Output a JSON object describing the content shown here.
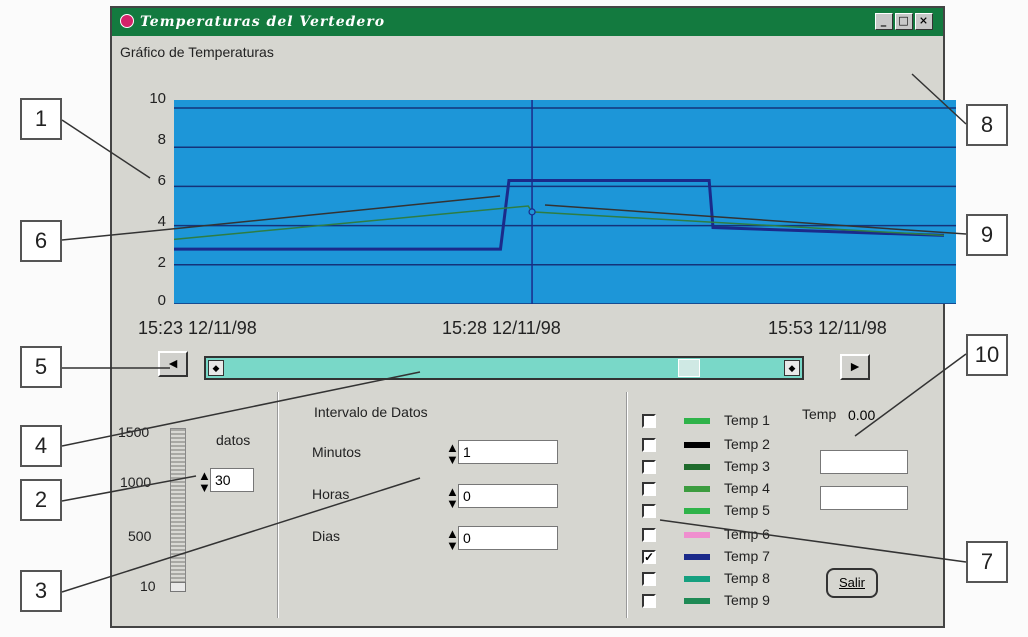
{
  "window": {
    "title": "Temperaturas del Vertedero",
    "controls": [
      "_",
      "□",
      "×"
    ]
  },
  "chart_title": "Gráfico de Temperaturas",
  "chart_data": {
    "type": "line",
    "ylim": [
      0,
      10
    ],
    "y_ticks": [
      "10",
      "8",
      "6",
      "4",
      "2",
      "0"
    ],
    "x_tick_labels": [
      "15:23 12/11/98",
      "15:28 12/11/98",
      "15:53 12/11/98"
    ],
    "grid": true,
    "background": "#1d96d8",
    "series": [
      {
        "color": "#1b2a8a",
        "x": [
          0,
          0.424,
          0.435,
          0.695,
          0.7,
          1.0
        ],
        "y": [
          2.8,
          2.8,
          6.3,
          6.3,
          3.9,
          3.5
        ]
      },
      {
        "color": "#2e7d43",
        "x": [
          0,
          0.46,
          0.465,
          1.0
        ],
        "y": [
          3.3,
          5.0,
          4.7,
          3.5
        ]
      }
    ],
    "cursor": {
      "x": 0.465,
      "y": 4.7
    }
  },
  "scroll": {
    "left_button": "◄",
    "right_button": "►",
    "thumb": 0.8
  },
  "datos": {
    "label": "datos",
    "value": "30",
    "scale_labels": [
      "1500",
      "1000",
      "500",
      "10"
    ],
    "level": 0.0
  },
  "intervalo": {
    "title": "Intervalo de Datos",
    "rows": [
      {
        "label": "Minutos",
        "value": "1"
      },
      {
        "label": "Horas",
        "value": "0"
      },
      {
        "label": "Dias",
        "value": "0"
      }
    ]
  },
  "temps": [
    {
      "label": "Temp 1",
      "checked": false,
      "color": "#2fb34a"
    },
    {
      "label": "Temp 2",
      "checked": false,
      "color": "#000000"
    },
    {
      "label": "Temp 3",
      "checked": false,
      "color": "#1f6b2c"
    },
    {
      "label": "Temp 4",
      "checked": false,
      "color": "#3c9c3f"
    },
    {
      "label": "Temp 5",
      "checked": false,
      "color": "#2fb34a"
    },
    {
      "label": "Temp 6",
      "checked": false,
      "color": "#ef8fcf"
    },
    {
      "label": "Temp 7",
      "checked": true,
      "color": "#1b2a8a"
    },
    {
      "label": "Temp 8",
      "checked": false,
      "color": "#16a07f"
    },
    {
      "label": "Temp 9",
      "checked": false,
      "color": "#1f8a55"
    }
  ],
  "temp_readout": {
    "label": "Temp",
    "value": "0.00"
  },
  "exit_button": "Salir",
  "callouts": [
    "1",
    "2",
    "3",
    "4",
    "5",
    "6",
    "7",
    "8",
    "9",
    "10"
  ]
}
